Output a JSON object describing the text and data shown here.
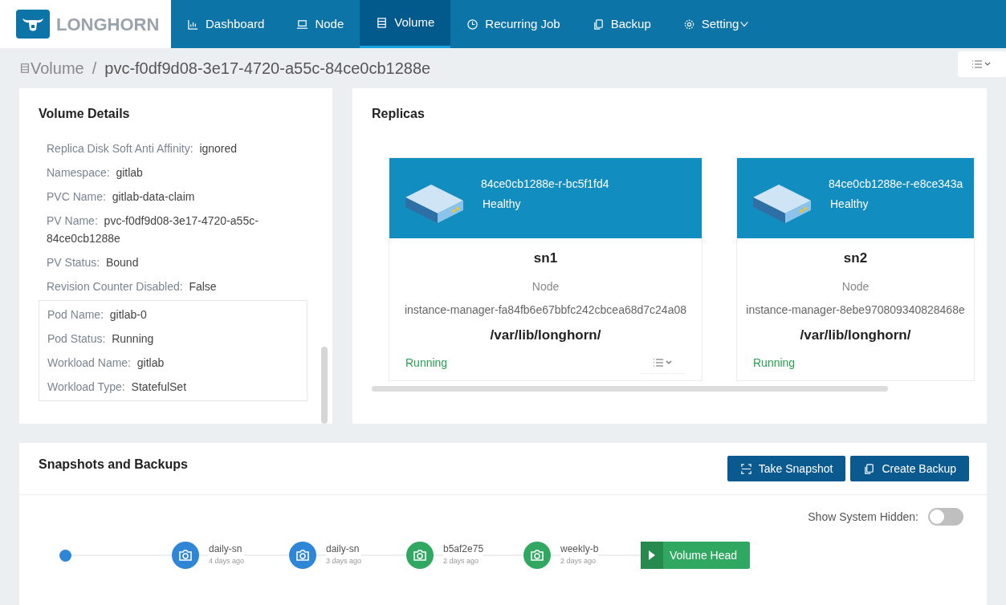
{
  "brand": {
    "name": "LONGHORN"
  },
  "nav": [
    {
      "label": "Dashboard",
      "selected": false
    },
    {
      "label": "Node",
      "selected": false
    },
    {
      "label": "Volume",
      "selected": true
    },
    {
      "label": "Recurring Job",
      "selected": false
    },
    {
      "label": "Backup",
      "selected": false
    },
    {
      "label": "Setting",
      "selected": false,
      "dropdown": true
    }
  ],
  "breadcrumb": {
    "parent": "Volume",
    "separator": "/",
    "current": "pvc-f0df9d08-3e17-4720-a55c-84ce0cb1288e"
  },
  "volume_details": {
    "title": "Volume Details",
    "fields": [
      {
        "label": "Replica Disk Soft Anti Affinity:",
        "value": "ignored"
      },
      {
        "label": "Namespace:",
        "value": "gitlab"
      },
      {
        "label": "PVC Name:",
        "value": "gitlab-data-claim"
      },
      {
        "label": "PV Name:",
        "value": "pvc-f0df9d08-3e17-4720-a55c-84ce0cb1288e"
      },
      {
        "label": "PV Status:",
        "value": "Bound"
      },
      {
        "label": "Revision Counter Disabled:",
        "value": "False"
      }
    ],
    "pod_fields": [
      {
        "label": "Pod Name:",
        "value": "gitlab-0"
      },
      {
        "label": "Pod Status:",
        "value": "Running"
      },
      {
        "label": "Workload Name:",
        "value": "gitlab"
      },
      {
        "label": "Workload Type:",
        "value": "StatefulSet"
      }
    ]
  },
  "replicas": {
    "title": "Replicas",
    "items": [
      {
        "name": "84ce0cb1288e-r-bc5f1fd4",
        "health": "Healthy",
        "node": "sn1",
        "node_label": "Node",
        "instance_manager": "instance-manager-fa84fb6e67bbfc242cbcea68d7c24a08",
        "path": "/var/lib/longhorn/",
        "state": "Running",
        "menu": true
      },
      {
        "name": "84ce0cb1288e-r-e8ce343a",
        "health": "Healthy",
        "node": "sn2",
        "node_label": "Node",
        "instance_manager": "instance-manager-8ebe970809340828468e",
        "path": "/var/lib/longhorn/",
        "state": "Running",
        "menu": false
      }
    ]
  },
  "snapshots": {
    "title": "Snapshots and Backups",
    "buttons": [
      {
        "label": "Take Snapshot"
      },
      {
        "label": "Create Backup"
      }
    ],
    "show_system_hidden": {
      "label": "Show System Hidden:",
      "on": false
    },
    "timeline": [
      {
        "kind": "start",
        "color": "#2f86d6"
      },
      {
        "kind": "snapshot",
        "name": "daily-sn",
        "age": "4 days ago",
        "color": "#2f86d6"
      },
      {
        "kind": "snapshot",
        "name": "daily-sn",
        "age": "3 days ago",
        "color": "#2f86d6"
      },
      {
        "kind": "snapshot",
        "name": "b5af2e75",
        "age": "2 days ago",
        "color": "#30a862"
      },
      {
        "kind": "snapshot",
        "name": "weekly-b",
        "age": "2 days ago",
        "color": "#30a862"
      },
      {
        "kind": "head",
        "label": "Volume Head"
      }
    ]
  }
}
